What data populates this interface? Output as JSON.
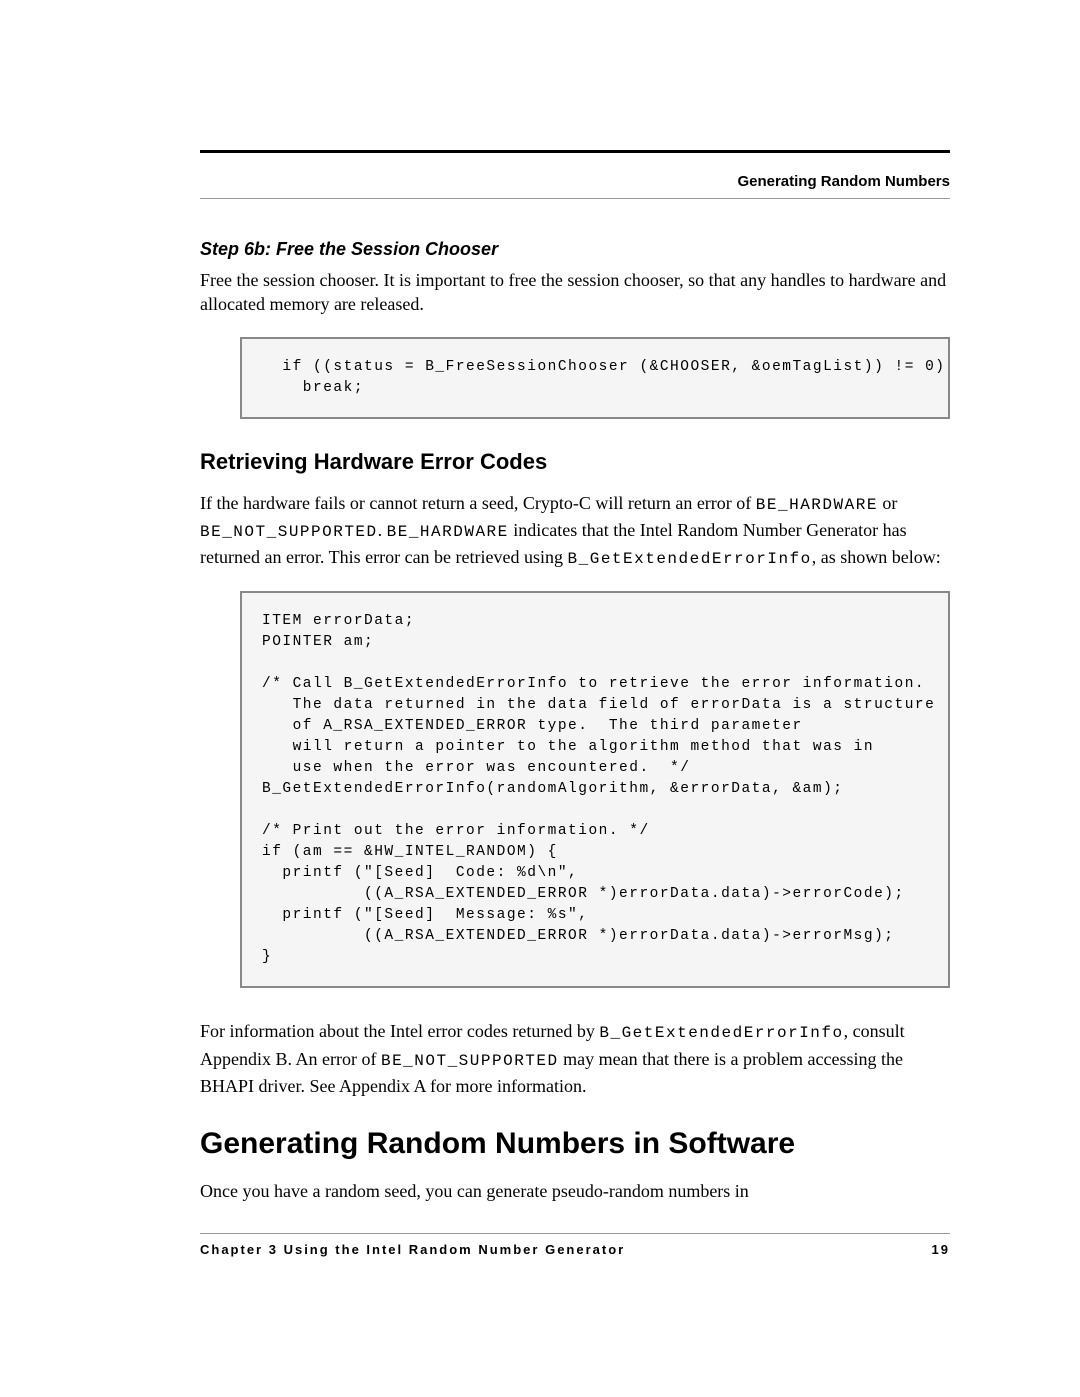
{
  "running_header": "Generating Random Numbers",
  "step_heading": "Step 6b: Free the Session Chooser",
  "step_body": "Free the session chooser. It is important to free the session chooser, so that any handles to hardware and allocated memory are released.",
  "code1": "  if ((status = B_FreeSessionChooser (&CHOOSER, &oemTagList)) != 0)\n    break;",
  "section2_heading": "Retrieving Hardware Error Codes",
  "para2_a": "If the hardware fails or cannot return a seed, Crypto-C will return an error of ",
  "para2_b": "BE_HARDWARE",
  "para2_c": " or ",
  "para2_d": "BE_NOT_SUPPORTED",
  "para2_e": ". ",
  "para2_f": "BE_HARDWARE",
  "para2_g": " indicates that the Intel Random Number Generator has returned an error. This error can be retrieved using ",
  "para2_h": "B_GetExtendedErrorInfo",
  "para2_i": ", as shown below:",
  "code2": "ITEM errorData;\nPOINTER am;\n\n/* Call B_GetExtendedErrorInfo to retrieve the error information.\n   The data returned in the data field of errorData is a structure\n   of A_RSA_EXTENDED_ERROR type.  The third parameter\n   will return a pointer to the algorithm method that was in\n   use when the error was encountered.  */\nB_GetExtendedErrorInfo(randomAlgorithm, &errorData, &am);\n\n/* Print out the error information. */\nif (am == &HW_INTEL_RANDOM) {\n  printf (\"[Seed]  Code: %d\\n\",\n          ((A_RSA_EXTENDED_ERROR *)errorData.data)->errorCode);\n  printf (\"[Seed]  Message: %s\",\n          ((A_RSA_EXTENDED_ERROR *)errorData.data)->errorMsg);\n}",
  "para3_a": "For information about the Intel error codes returned by ",
  "para3_b": "B_GetExtendedErrorInfo",
  "para3_c": ", consult Appendix B. An error of ",
  "para3_d": "BE_NOT_SUPPORTED",
  "para3_e": " may mean that there is a problem accessing the BHAPI driver. See Appendix A for more information.",
  "section3_heading": "Generating Random Numbers in Software",
  "para4": "Once you have a random seed, you can generate pseudo-random numbers in",
  "footer_left": "Chapter 3  Using the Intel Random Number Generator",
  "footer_right": "19"
}
